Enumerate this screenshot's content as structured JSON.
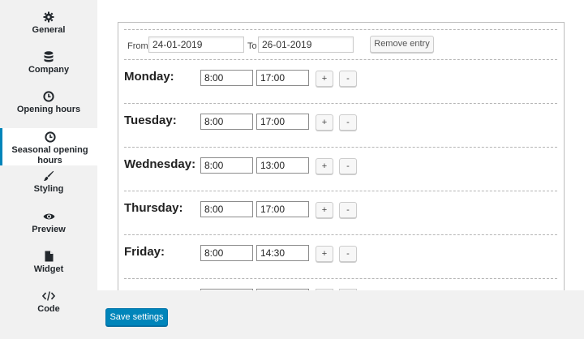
{
  "sidebar": {
    "items": [
      {
        "label": "General",
        "icon": "gear-icon"
      },
      {
        "label": "Company",
        "icon": "database-icon"
      },
      {
        "label": "Opening hours",
        "icon": "clock-icon"
      },
      {
        "label": "Seasonal opening hours",
        "icon": "clock-icon",
        "active": true
      },
      {
        "label": "Styling",
        "icon": "brush-icon"
      },
      {
        "label": "Preview",
        "icon": "eye-icon"
      },
      {
        "label": "Widget",
        "icon": "document-icon"
      },
      {
        "label": "Code",
        "icon": "code-icon"
      }
    ]
  },
  "entry": {
    "from_label": "From",
    "from_value": "24-01-2019",
    "to_label": "To",
    "to_value": "26-01-2019",
    "remove_label": "Remove entry"
  },
  "days": [
    {
      "label": "Monday:",
      "open": "8:00",
      "close": "17:00"
    },
    {
      "label": "Tuesday:",
      "open": "8:00",
      "close": "17:00"
    },
    {
      "label": "Wednesday:",
      "open": "8:00",
      "close": "13:00"
    },
    {
      "label": "Thursday:",
      "open": "8:00",
      "close": "17:00"
    },
    {
      "label": "Friday:",
      "open": "8:00",
      "close": "14:30"
    }
  ],
  "buttons": {
    "plus": "+",
    "minus": "-"
  },
  "footer": {
    "save_label": "Save settings"
  },
  "colors": {
    "accent": "#0085ba"
  }
}
